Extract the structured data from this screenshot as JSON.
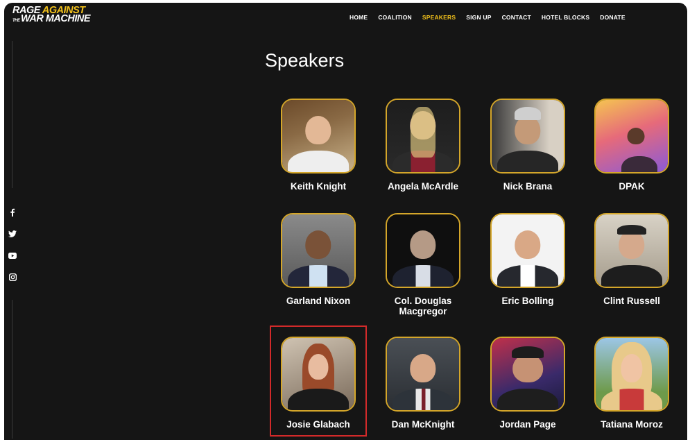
{
  "logo": {
    "line1_white": "RAGE ",
    "line1_yellow": "AGAINST",
    "the": "THE",
    "line2": "WAR MACHINE"
  },
  "nav": [
    {
      "label": "HOME",
      "active": false
    },
    {
      "label": "COALITION",
      "active": false
    },
    {
      "label": "SPEAKERS",
      "active": true
    },
    {
      "label": "SIGN UP",
      "active": false
    },
    {
      "label": "CONTACT",
      "active": false
    },
    {
      "label": "HOTEL BLOCKS",
      "active": false
    },
    {
      "label": "DONATE",
      "active": false
    }
  ],
  "social": [
    "facebook-icon",
    "twitter-icon",
    "youtube-icon",
    "instagram-icon"
  ],
  "page_title": "Speakers",
  "speakers": [
    {
      "name": "Keith Knight"
    },
    {
      "name": "Angela McArdle"
    },
    {
      "name": "Nick Brana"
    },
    {
      "name": "DPAK"
    },
    {
      "name": "Garland Nixon"
    },
    {
      "name": "Col. Douglas Macgregor"
    },
    {
      "name": "Eric Bolling"
    },
    {
      "name": "Clint Russell"
    },
    {
      "name": "Josie Glabach"
    },
    {
      "name": "Dan McKnight"
    },
    {
      "name": "Jordan Page"
    },
    {
      "name": "Tatiana Moroz"
    }
  ],
  "colors": {
    "accent": "#f2c11b",
    "background": "#151515",
    "photo_border": "#d4a62a",
    "highlight": "#d22a2a"
  }
}
